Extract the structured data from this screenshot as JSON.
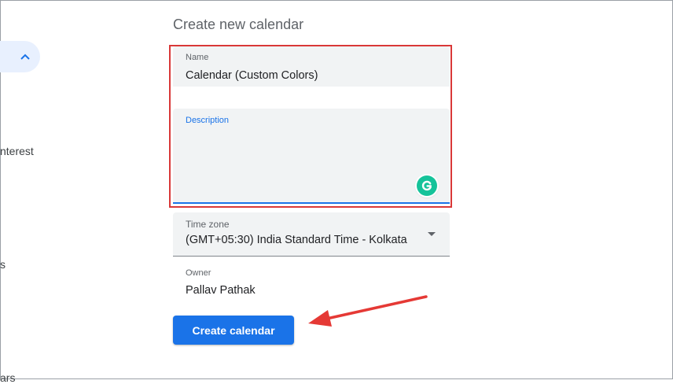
{
  "page": {
    "title": "Create new calendar"
  },
  "sidebar": {
    "fragments": [
      "nterest",
      "s",
      "ars"
    ]
  },
  "form": {
    "name": {
      "label": "Name",
      "value": "Calendar (Custom Colors)"
    },
    "description": {
      "label": "Description",
      "value": ""
    },
    "timezone": {
      "label": "Time zone",
      "value": "(GMT+05:30) India Standard Time - Kolkata"
    },
    "owner": {
      "label": "Owner",
      "value": "Pallav Pathak"
    }
  },
  "actions": {
    "create_label": "Create calendar"
  },
  "colors": {
    "accent": "#1a73e8",
    "annotation": "#e53935",
    "grammarly": "#15c39a"
  }
}
